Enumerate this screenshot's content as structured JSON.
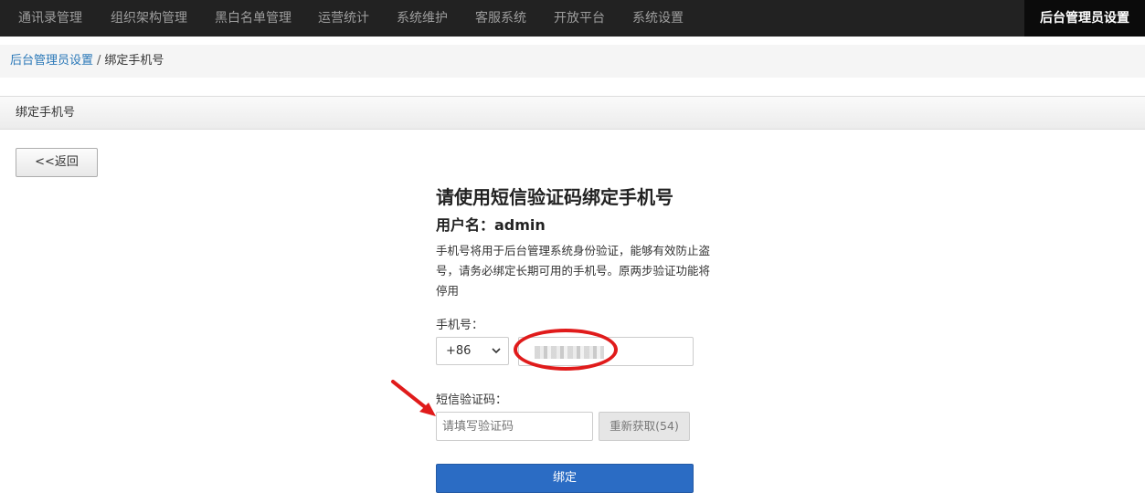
{
  "topnav": {
    "menu": [
      "通讯录管理",
      "组织架构管理",
      "黑白名单管理",
      "运营统计",
      "系统维护",
      "客服系统",
      "开放平台",
      "系统设置"
    ],
    "right_link": "后台管理员设置"
  },
  "breadcrumb": {
    "parent": "后台管理员设置",
    "separator": "/",
    "current": "绑定手机号"
  },
  "panel": {
    "heading": "绑定手机号"
  },
  "back_button": "<<返回",
  "form": {
    "title": "请使用短信验证码绑定手机号",
    "user_line": "用户名：admin",
    "description": "手机号将用于后台管理系统身份验证，能够有效防止盗号，请务必绑定长期可用的手机号。原两步验证功能将停用",
    "phone_label": "手机号：",
    "country_code": "+86",
    "phone_value_state": "blurred",
    "code_label": "短信验证码：",
    "code_placeholder": "请填写验证码",
    "resend_label": "重新获取(54)",
    "submit_label": "绑定"
  },
  "colors": {
    "nav_bg": "#222222",
    "primary": "#2b6cc4",
    "annotation": "#e01b1b",
    "link": "#2a78b8"
  }
}
